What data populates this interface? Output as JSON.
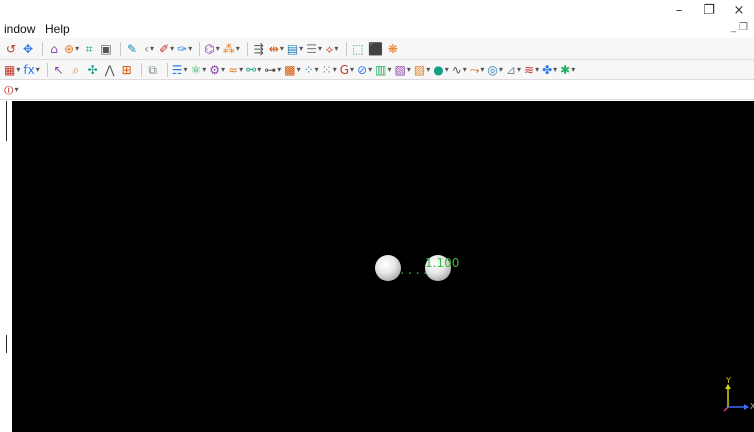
{
  "window": {
    "minimize": "–",
    "restore": "❐",
    "close": "×"
  },
  "menu": {
    "items": [
      "indow",
      "Help"
    ],
    "mdi_controls": "_ ❐"
  },
  "toolbar1": [
    {
      "name": "rotate-tool-icon",
      "glyph": "↺"
    },
    {
      "name": "translate-tool-icon",
      "glyph": "✥"
    },
    {
      "sep": true
    },
    {
      "name": "home-view-icon",
      "glyph": "⌂"
    },
    {
      "name": "target-icon",
      "glyph": "⊕",
      "dd": true
    },
    {
      "name": "fit-view-icon",
      "glyph": "⌗"
    },
    {
      "name": "camera-icon",
      "glyph": "▣"
    },
    {
      "sep": true
    },
    {
      "name": "pencil-icon",
      "glyph": "✎"
    },
    {
      "name": "undo-icon",
      "glyph": "‹",
      "dd": true
    },
    {
      "name": "draw-bond-icon",
      "glyph": "✐",
      "dd": true
    },
    {
      "name": "eraser-icon",
      "glyph": "✑",
      "dd": true
    },
    {
      "sep": true
    },
    {
      "name": "ring-icon",
      "glyph": "⌬",
      "dd": true
    },
    {
      "name": "fragment-icon",
      "glyph": "⁂",
      "dd": true
    },
    {
      "sep": true
    },
    {
      "name": "align-icon",
      "glyph": "⇶"
    },
    {
      "name": "measure-icon",
      "glyph": "⇹",
      "dd": true
    },
    {
      "name": "table-icon",
      "glyph": "▤",
      "dd": true
    },
    {
      "name": "list-icon",
      "glyph": "☰",
      "dd": true
    },
    {
      "name": "add-hydrogen-icon",
      "glyph": "⟡",
      "dd": true
    },
    {
      "sep": true
    },
    {
      "name": "cell-icon",
      "glyph": "⬚"
    },
    {
      "name": "supercell-icon",
      "glyph": "⬛"
    },
    {
      "name": "symmetry-icon",
      "glyph": "❋"
    }
  ],
  "toolbar2": [
    {
      "name": "spreadsheet-icon",
      "glyph": "▦",
      "dd": true
    },
    {
      "name": "formula-icon",
      "glyph": "fx",
      "dd": true
    },
    {
      "sep": true
    },
    {
      "name": "select-icon",
      "glyph": "↖"
    },
    {
      "name": "lasso-icon",
      "glyph": "⌕"
    },
    {
      "name": "pan-icon",
      "glyph": "✣"
    },
    {
      "name": "chain-icon",
      "glyph": "⋀"
    },
    {
      "name": "group-icon",
      "glyph": "⊞"
    },
    {
      "sep": true
    },
    {
      "name": "copy-icon",
      "glyph": "⧉"
    },
    {
      "sep": true
    },
    {
      "name": "crystal-icon",
      "glyph": "☴",
      "dd": true
    },
    {
      "name": "molecule-icon",
      "glyph": "⚛",
      "dd": true
    },
    {
      "name": "gear-icon",
      "glyph": "⚙",
      "dd": true
    },
    {
      "name": "wave-icon",
      "glyph": "≈",
      "dd": true
    },
    {
      "name": "bonds-icon",
      "glyph": "⚯",
      "dd": true
    },
    {
      "name": "chart-icon",
      "glyph": "⊶",
      "dd": true
    },
    {
      "name": "grid-icon",
      "glyph": "▩",
      "dd": true
    },
    {
      "name": "dots-icon",
      "glyph": "⁘",
      "dd": true
    },
    {
      "name": "lattice-icon",
      "glyph": "⁙",
      "dd": true
    },
    {
      "name": "g-icon",
      "glyph": "G",
      "dd": true
    },
    {
      "name": "gauge-icon",
      "glyph": "⊘",
      "dd": true
    },
    {
      "name": "matrix-icon",
      "glyph": "▥",
      "dd": true
    },
    {
      "name": "surface-icon",
      "glyph": "▧",
      "dd": true
    },
    {
      "name": "box-icon",
      "glyph": "▨",
      "dd": true
    },
    {
      "name": "sphere-icon",
      "glyph": "●",
      "dd": true
    },
    {
      "name": "spectrum-icon",
      "glyph": "∿",
      "dd": true
    },
    {
      "name": "dynamics-icon",
      "glyph": "⤳",
      "dd": true
    },
    {
      "name": "orbital-icon",
      "glyph": "◎",
      "dd": true
    },
    {
      "name": "plot-icon",
      "glyph": "⊿",
      "dd": true
    },
    {
      "name": "phonon-icon",
      "glyph": "≋",
      "dd": true
    },
    {
      "name": "analysis-icon",
      "glyph": "✤",
      "dd": true
    },
    {
      "name": "tools-icon",
      "glyph": "✱",
      "dd": true
    }
  ],
  "toolbar3": [
    {
      "name": "dropdown-icon",
      "glyph": "⏼",
      "dd": true
    }
  ],
  "viewport": {
    "distance_label": "1.100",
    "dots": "....",
    "axis_y": "Y",
    "axis_x": "X",
    "colors": {
      "background": "#000000",
      "label": "#3dbb3d",
      "axis_y": "#d6d600",
      "axis_x": "#3b6cff",
      "axis_z": "#d9409f"
    }
  }
}
